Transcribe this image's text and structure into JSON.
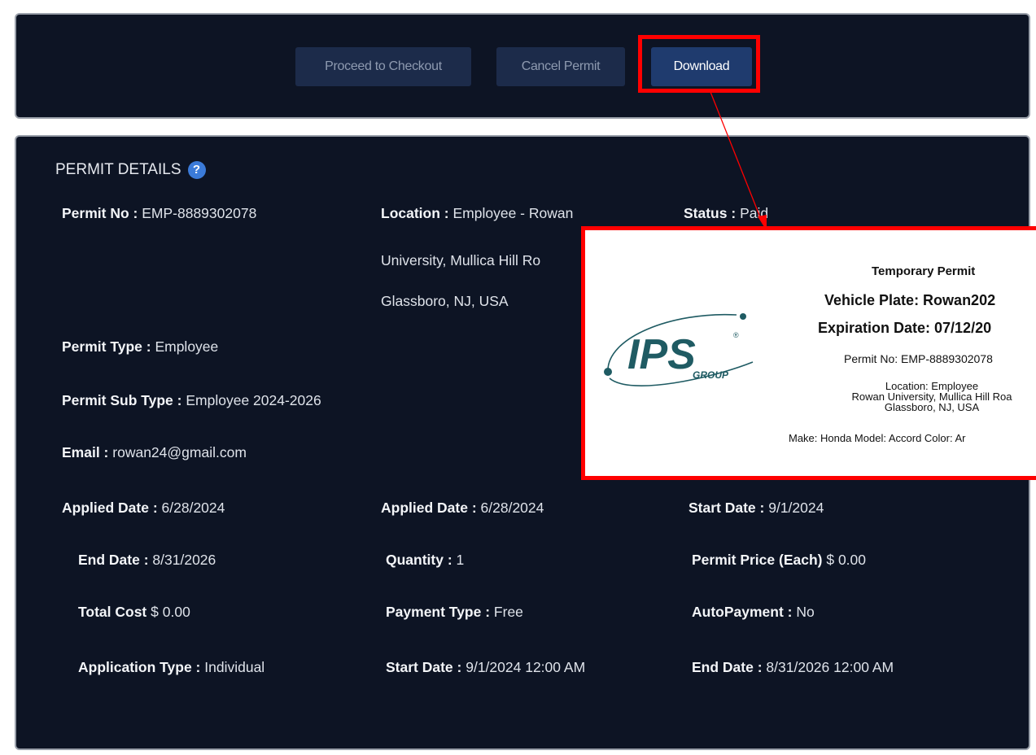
{
  "toolbar": {
    "checkout_label": "Proceed to Checkout",
    "cancel_label": "Cancel Permit",
    "download_label": "Download"
  },
  "details": {
    "section_title": "PERMIT DETAILS",
    "help_glyph": "?",
    "permit_no_label": "Permit No :",
    "permit_no_value": "EMP-8889302078",
    "location_label": "Location :",
    "location_line1": "Employee - Rowan",
    "location_line2": "University, Mullica Hill Ro",
    "location_line3": "Glassboro, NJ, USA",
    "status_label": "Status :",
    "status_value": "Paid",
    "permit_type_label": "Permit Type :",
    "permit_type_value": "Employee",
    "sub_type_label": "Permit Sub Type :",
    "sub_type_value": "Employee 2024-2026",
    "email_label": "Email :",
    "email_value": "rowan24@gmail.com",
    "applied_label": "Applied Date :",
    "applied_value": "6/28/2024",
    "applied2_label": "Applied Date :",
    "applied2_value": "6/28/2024",
    "start_label": "Start Date :",
    "start_value": "9/1/2024",
    "end_label": "End Date :",
    "end_value": "8/31/2026",
    "quantity_label": "Quantity :",
    "quantity_value": "1",
    "price_label": "Permit Price (Each)",
    "price_value": "$ 0.00",
    "total_label": "Total Cost",
    "total_value": "$ 0.00",
    "payment_label": "Payment Type :",
    "payment_value": "Free",
    "autopay_label": "AutoPayment :",
    "autopay_value": "No",
    "app_type_label": "Application Type :",
    "app_type_value": "Individual",
    "start_dt_label": "Start Date :",
    "start_dt_value": "9/1/2024 12:00 AM",
    "end_dt_label": "End Date :",
    "end_dt_value": "8/31/2026 12:00 AM"
  },
  "popup": {
    "title": "Temporary Permit",
    "plate": "Vehicle Plate: Rowan202",
    "expiration": "Expiration Date: 07/12/20",
    "permit_no": "Permit No: EMP-8889302078",
    "location_line1": "Location: Employee",
    "location_line2": "Rowan University, Mullica Hill Roa",
    "location_line3": "Glassboro, NJ, USA",
    "make_model": "Make: Honda Model: Accord Color: Ar",
    "logo_text": "IPS",
    "logo_sub": "GROUP",
    "logo_mark": "®"
  },
  "colors": {
    "panel_bg": "#0d1424",
    "button_bg": "#1c2b4a",
    "download_bg": "#1f3b6e",
    "highlight": "#ff0000",
    "logo_teal": "#1f5b63"
  }
}
